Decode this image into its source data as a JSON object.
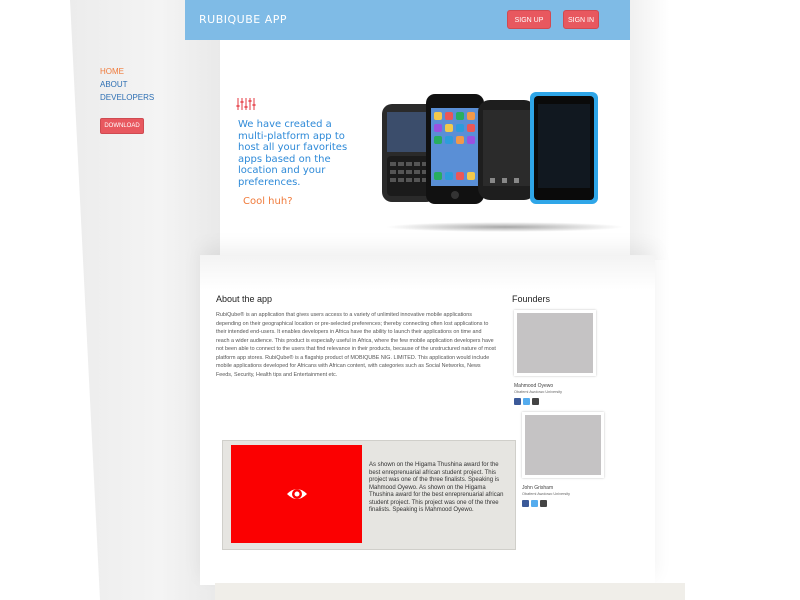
{
  "header": {
    "brand": "RUBIQUBE APP",
    "signup_label": "SIGN UP",
    "signin_label": "SIGN IN"
  },
  "nav": {
    "items": [
      "HOME",
      "ABOUT",
      "DEVELOPERS"
    ],
    "active": "HOME",
    "download_label": "DOWNLOAD"
  },
  "hero": {
    "headline": "We have created a multi-platform app to host all your favorites apps based on the location and your preferences.",
    "subline": "Cool huh?"
  },
  "about": {
    "title": "About the app",
    "text": "RubiQube® is an application that gives users access to a variety of unlimited innovative mobile applications depending on their geographical location or pre-selected preferences; thereby connecting often lost applications to their intended end-users. It enables developers in Africa have the ability to launch their applications on time and reach a wider audience. This product is especially useful in Africa, where the few mobile application developers have not been able to connect to the users that find relevance in their products, because of the unstructured nature of most platform app stores. RubiQube® is a flagship product of MOBIQUBE NIG. LIMITED. This application would include mobile applications developed for Africans with African content, with categories such as Social Networks, News Feeds, Security, Health tips and Entertainment etc."
  },
  "founders": {
    "title": "Founders",
    "people": [
      {
        "name": "Mahmood Oyewo",
        "university": "Obafemi Awolowo University"
      },
      {
        "name": "John Grisham",
        "university": "Obafemi Awolowo University"
      }
    ]
  },
  "award": {
    "caption": "As shown on the Higama Thushina award for the best enreprenuarial african student project. This project was one of the three finalists. Speaking is Mahmood Oyewo. As shown on the Higama Thushina award for the best enreprenuarial african student project. This project was one of the three finalists. Speaking is Mahmood Oyewo."
  },
  "colors": {
    "header_bg": "#7fbbe6",
    "accent_red": "#e8585f",
    "link_blue": "#2d6fb3",
    "active_orange": "#f07a3a",
    "award_red": "#fb0001"
  },
  "icons": {
    "hero": "equalizer-icon",
    "award": "eye-icon",
    "socials": [
      "facebook-icon",
      "twitter-icon",
      "google-plus-icon"
    ]
  }
}
